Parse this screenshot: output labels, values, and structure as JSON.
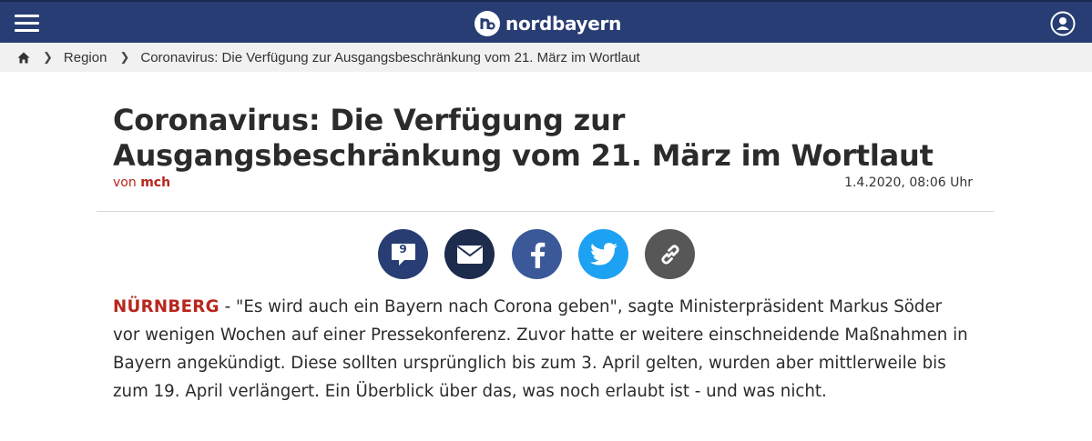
{
  "header": {
    "logo_text": "nordbayern",
    "brand_color": "#273d73",
    "icons": {
      "menu": "hamburger-menu-icon",
      "logo": "nordbayern-logo-mark",
      "user": "user-account-icon"
    }
  },
  "breadcrumb": {
    "home_icon": "home-icon",
    "items": [
      "Region",
      "Coronavirus: Die Verfügung zur Ausgangsbeschränkung vom 21. März im Wortlaut"
    ]
  },
  "article": {
    "headline_line1": "Coronavirus: Die Verfügung zur",
    "headline_line2": "Ausgangsbeschränkung vom 21. März im Wortlaut",
    "byline_prefix": "von",
    "author": "mch",
    "date": "1.4.2020, 08:06 Uhr",
    "accent_color": "#b8261c",
    "dateline": "NÜRNBERG",
    "lead_text": " - \"Es wird auch ein Bayern nach Corona geben\", sagte Ministerpräsident Markus Söder vor wenigen Wochen auf einer Pressekonferenz. Zuvor hatte er weitere einschneidende Maßnahmen in Bayern angekündigt. Diese sollten ursprünglich bis zum 3. April gelten, wurden aber mittlerweile bis zum 19. April verlängert. Ein Überblick über das, was noch erlaubt ist - und was nicht."
  },
  "share": {
    "comment_count": "9",
    "buttons": [
      {
        "icon": "comment-bubble-icon",
        "color": "#273d73"
      },
      {
        "icon": "mail-icon",
        "color": "#1d2b4d"
      },
      {
        "icon": "facebook-icon",
        "color": "#3b5998"
      },
      {
        "icon": "twitter-icon",
        "color": "#1da1f2"
      },
      {
        "icon": "link-icon",
        "color": "#575757"
      }
    ]
  }
}
